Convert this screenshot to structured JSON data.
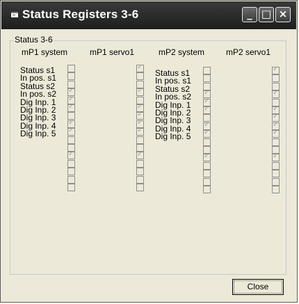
{
  "window": {
    "title": "Status Registers 3-6",
    "minimize_glyph": "_",
    "maximize_glyph": "□",
    "close_glyph": "×"
  },
  "group": {
    "label": "Status 3-6",
    "columns": [
      "mP1 system",
      "mP1 servo1",
      "mP2 system",
      "mP2 servo1"
    ]
  },
  "mp1_system": {
    "labels": [
      "Status s1",
      "In pos. s1",
      "Status s2",
      "In pos. s2",
      "Dig Inp. 1",
      "Dig Inp. 2",
      "Dig Inp. 3",
      "Dig Inp. 4",
      "Dig Inp. 5"
    ],
    "checked": [
      false,
      false,
      false,
      true,
      true,
      true,
      false,
      true,
      true,
      false,
      false,
      true,
      false,
      false,
      false,
      false
    ]
  },
  "mp1_servo1": {
    "checked": [
      true,
      false,
      false,
      true,
      false,
      true,
      true,
      true,
      true,
      false,
      false,
      true,
      false,
      false,
      false,
      false
    ]
  },
  "mp2_system": {
    "labels": [
      "Status s1",
      "In pos. s1",
      "Status s2",
      "In pos. s2",
      "Dig Inp. 1",
      "Dig Inp. 2",
      "Dig Inp. 3",
      "Dig Inp. 4",
      "Dig Inp. 5"
    ],
    "checked": [
      false,
      false,
      false,
      true,
      true,
      true,
      false,
      true,
      true,
      false,
      false,
      true,
      false,
      false,
      false,
      false
    ]
  },
  "mp2_servo1": {
    "checked": [
      true,
      false,
      false,
      true,
      false,
      true,
      true,
      true,
      true,
      false,
      false,
      true,
      false,
      false,
      false,
      false
    ]
  },
  "buttons": {
    "close": "Close"
  }
}
